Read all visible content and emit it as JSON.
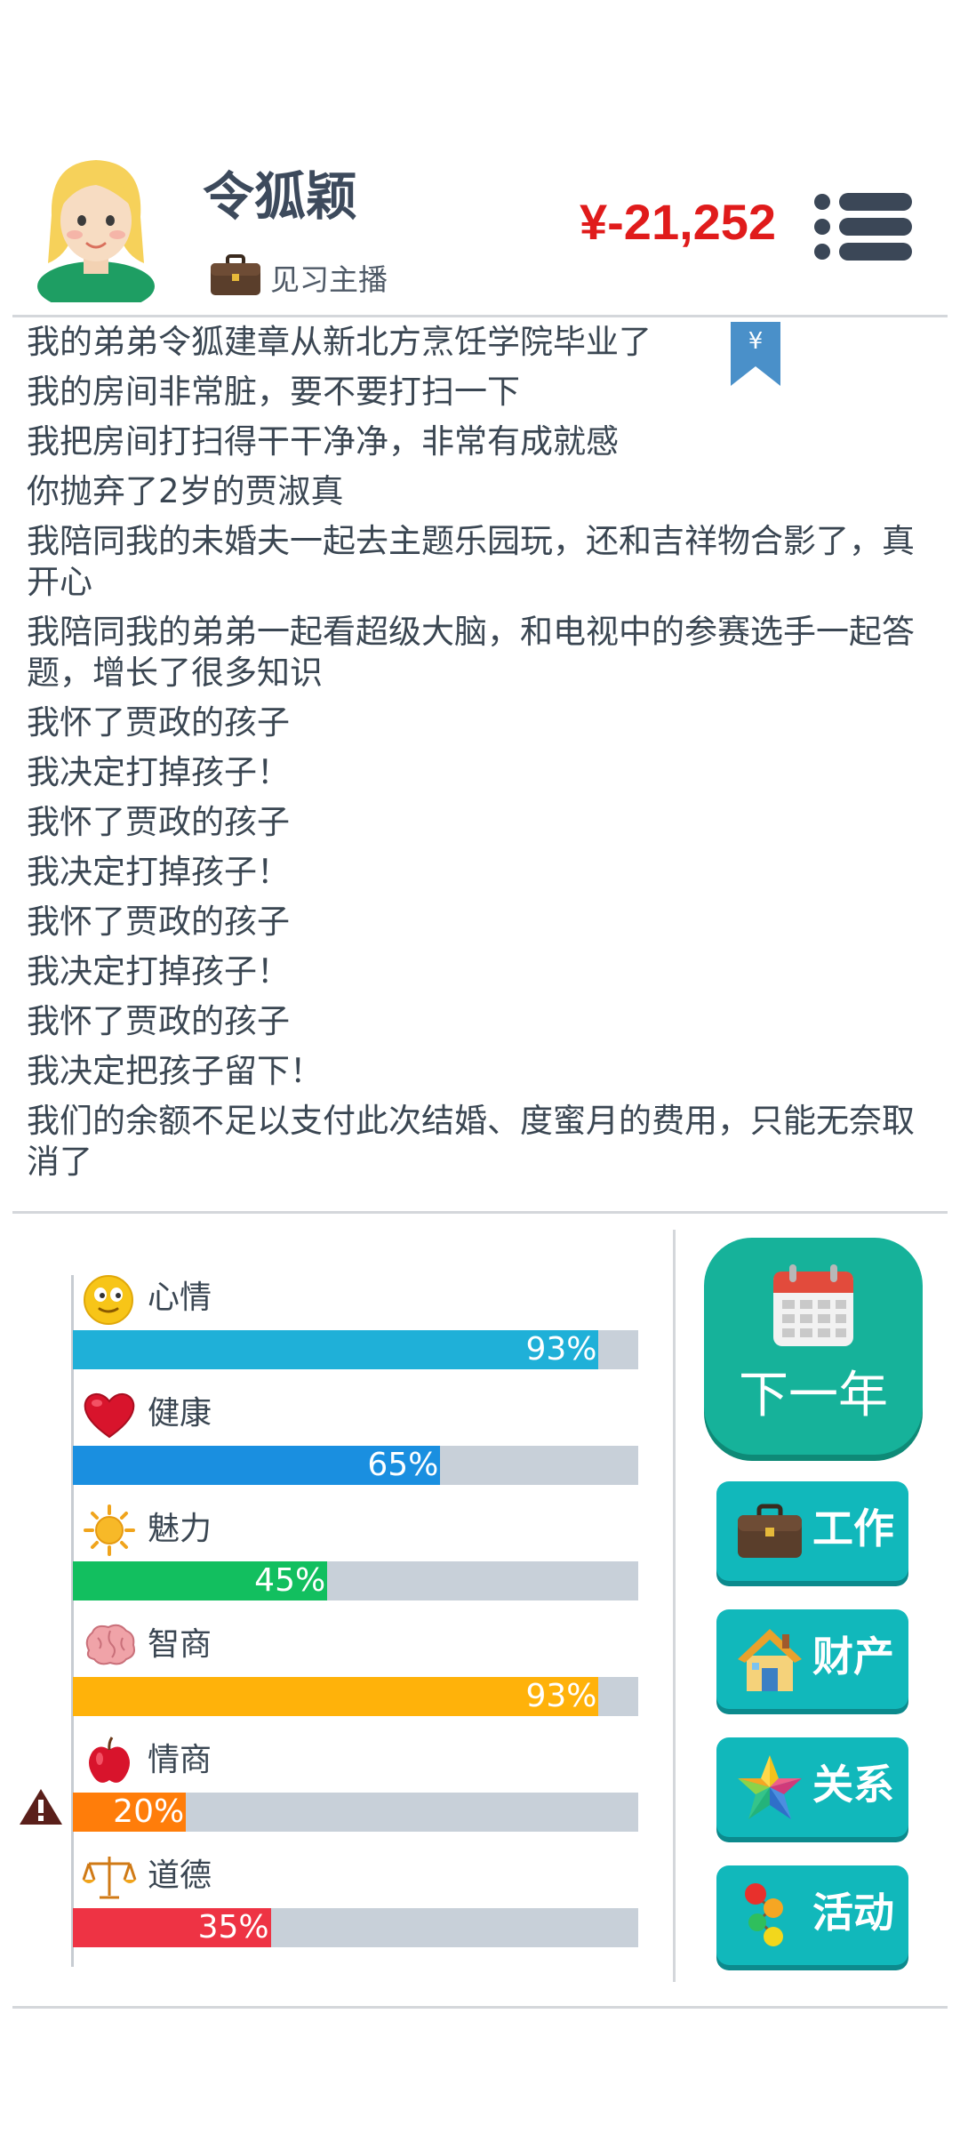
{
  "header": {
    "name": "令狐颖",
    "job": "见习主播",
    "balance": "¥-21,252"
  },
  "events": [
    "我的弟弟令狐建章从新北方烹饪学院毕业了",
    "我的房间非常脏，要不要打扫一下",
    "我把房间打扫得干干净净，非常有成就感",
    "你抛弃了2岁的贾淑真",
    "我陪同我的未婚夫一起去主题乐园玩，还和吉祥物合影了，真开心",
    "我陪同我的弟弟一起看超级大脑，和电视中的参赛选手一起答题，增长了很多知识",
    "我怀了贾政的孩子",
    "我决定打掉孩子！",
    "我怀了贾政的孩子",
    "我决定打掉孩子！",
    "我怀了贾政的孩子",
    "我决定打掉孩子！",
    "我怀了贾政的孩子",
    "我决定把孩子留下！",
    "我们的余额不足以支付此次结婚、度蜜月的费用，只能无奈取消了"
  ],
  "stats": [
    {
      "label": "心情",
      "value": 0.93,
      "display": "93%",
      "color": "#1fb0d8",
      "icon": "smiley-icon"
    },
    {
      "label": "健康",
      "value": 0.65,
      "display": "65%",
      "color": "#1a8fe0",
      "icon": "heart-icon"
    },
    {
      "label": "魅力",
      "value": 0.45,
      "display": "45%",
      "color": "#12bf5f",
      "icon": "sun-icon"
    },
    {
      "label": "智商",
      "value": 0.93,
      "display": "93%",
      "color": "#ffb20a",
      "icon": "brain-icon"
    },
    {
      "label": "情商",
      "value": 0.2,
      "display": "20%",
      "color": "#ff7d0a",
      "icon": "apple-icon"
    },
    {
      "label": "道德",
      "value": 0.35,
      "display": "35%",
      "color": "#ee3344",
      "icon": "scales-icon"
    }
  ],
  "actions": {
    "next_year": "下一年",
    "work": "工作",
    "property": "财产",
    "relations": "关系",
    "activities": "活动"
  }
}
